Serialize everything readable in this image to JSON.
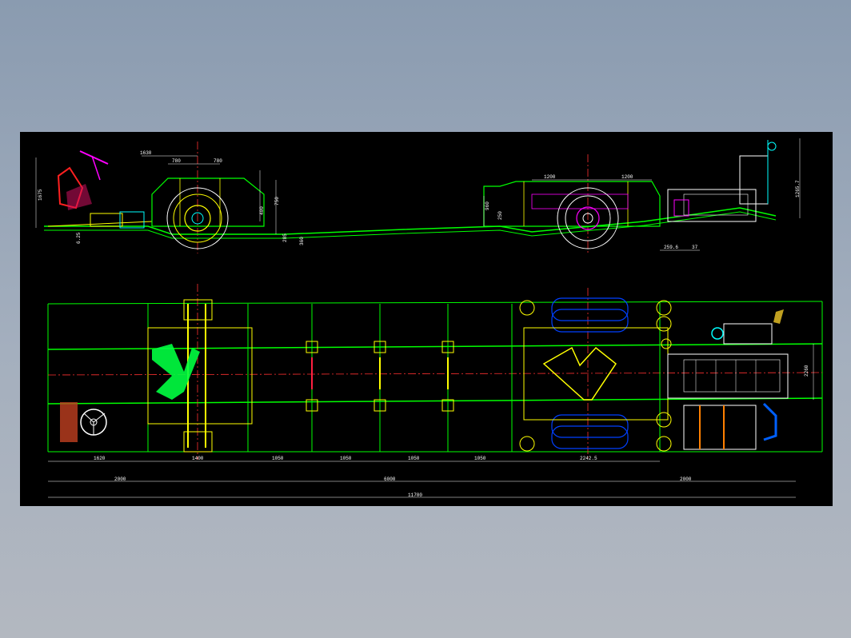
{
  "drawing": {
    "colors": {
      "background": "#000000",
      "frame": "#00ff00",
      "structure": "#ffff00",
      "centerline": "#ff3030",
      "dimension": "#ffffff",
      "axle": "#0040ff",
      "highlight": "#00ff40",
      "accent": "#ff00ff",
      "cyan": "#00ffff"
    },
    "side_view": {
      "top_dims": [
        "1630",
        "780",
        "780",
        "1200",
        "1200"
      ],
      "left_height": "1675",
      "heights": [
        "400",
        "750",
        "285",
        "960",
        "360",
        "250"
      ],
      "bottom_dims": [
        "6.25",
        "259.6",
        "37"
      ],
      "right_height": "1265.7"
    },
    "plan_view": {
      "row1_dims": [
        "1620",
        "1400",
        "1050",
        "1050",
        "1050",
        "1050",
        "2242.5"
      ],
      "row2_dims": [
        "2000",
        "6000",
        "2000"
      ],
      "total_dim": "11700",
      "right_width": "2260"
    }
  }
}
